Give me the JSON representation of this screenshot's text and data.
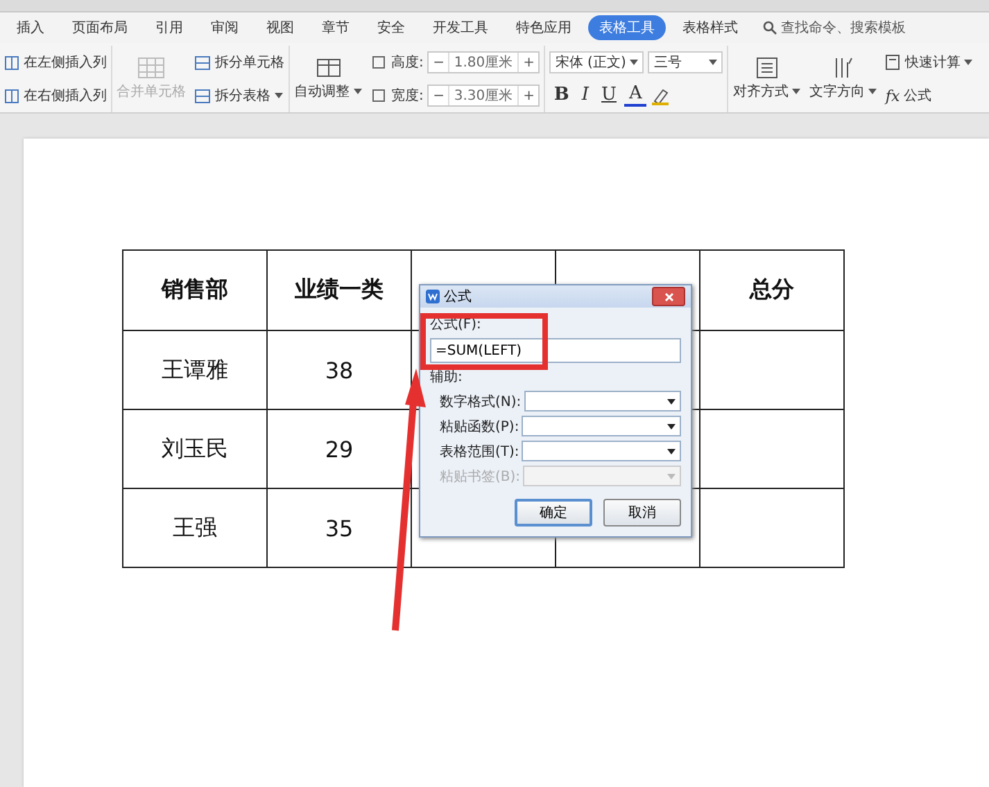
{
  "menu_tabs": [
    {
      "label": "插入",
      "selected": false
    },
    {
      "label": "页面布局",
      "selected": false
    },
    {
      "label": "引用",
      "selected": false
    },
    {
      "label": "审阅",
      "selected": false
    },
    {
      "label": "视图",
      "selected": false
    },
    {
      "label": "章节",
      "selected": false
    },
    {
      "label": "安全",
      "selected": false
    },
    {
      "label": "开发工具",
      "selected": false
    },
    {
      "label": "特色应用",
      "selected": false
    },
    {
      "label": "表格工具",
      "selected": true
    },
    {
      "label": "表格样式",
      "selected": false
    }
  ],
  "search": {
    "placeholder": "查找命令、搜索模板"
  },
  "ribbon": {
    "insert_columns": [
      "在左侧插入列",
      "在右侧插入列"
    ],
    "merge": {
      "label": "合并单元格",
      "disabled": true
    },
    "split": [
      "拆分单元格",
      "拆分表格"
    ],
    "auto_fit": "自动调整",
    "size_fields": [
      {
        "label": "高度:",
        "value": "1.80厘米",
        "minus": "−",
        "plus": "+"
      },
      {
        "label": "宽度:",
        "value": "3.30厘米",
        "minus": "−",
        "plus": "+"
      }
    ],
    "font": {
      "family": "宋体 (正文)",
      "size": "三号"
    },
    "format_buttons": [
      "B",
      "I",
      "U",
      "A"
    ],
    "layout_buttons": [
      "对齐方式",
      "文字方向"
    ],
    "quick_calc": "快速计算",
    "formula": {
      "symbol": "fx",
      "label": "公式"
    }
  },
  "table": {
    "columns": [
      "销售部",
      "业绩一类",
      "",
      "",
      "总分"
    ],
    "rows": [
      [
        "王谭雅",
        "38"
      ],
      [
        "刘玉民",
        "29"
      ],
      [
        "王强",
        "35"
      ]
    ]
  },
  "dialog": {
    "title": "公式",
    "formula_label": "公式(F):",
    "formula_value": "=SUM(LEFT)",
    "helper_label": "辅助:",
    "dropdowns": [
      {
        "label": "数字格式(N):",
        "disabled": false
      },
      {
        "label": "粘贴函数(P):",
        "disabled": false
      },
      {
        "label": "表格范围(T):",
        "disabled": false
      },
      {
        "label": "粘贴书签(B):",
        "disabled": true
      }
    ],
    "buttons": [
      {
        "label": "确定",
        "default": true
      },
      {
        "label": "取消",
        "default": false
      }
    ]
  }
}
